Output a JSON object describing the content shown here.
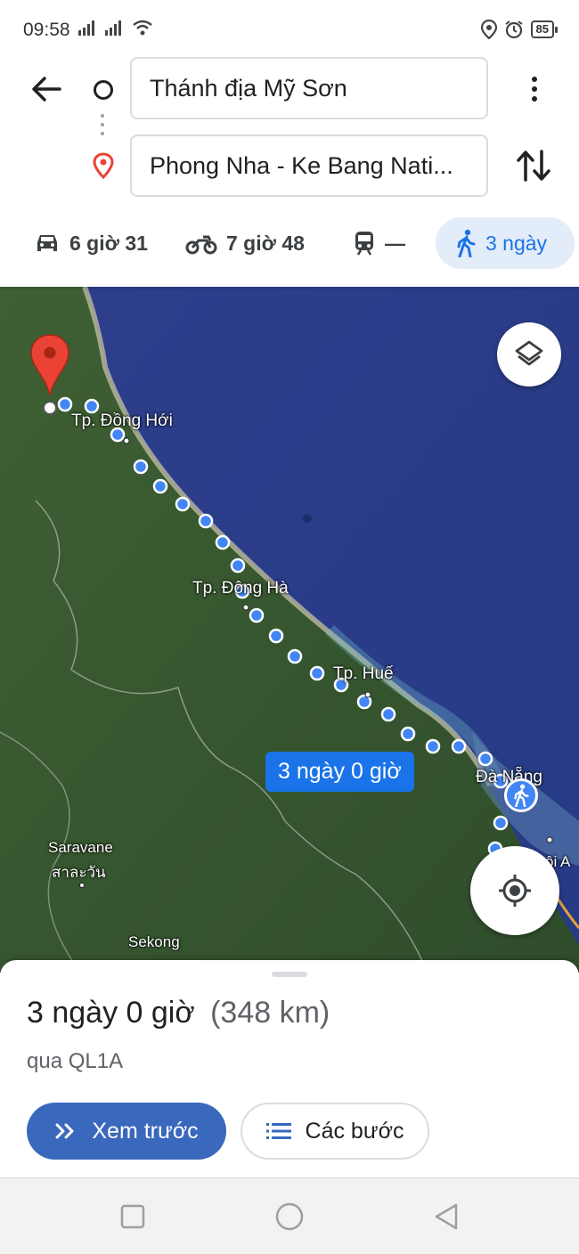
{
  "status_bar": {
    "time": "09:58",
    "battery": "85"
  },
  "route": {
    "origin": "Thánh địa Mỹ Sơn",
    "destination": "Phong Nha - Ke Bang Nati..."
  },
  "modes": {
    "car": "6 giờ 31",
    "motorbike": "7 giờ 48",
    "transit": "—",
    "walk": "3 ngày"
  },
  "map": {
    "labels": {
      "dong_hoi": "Tp. Đồng Hới",
      "dong_ha": "Tp. Đông Hà",
      "hue": "Tp. Huế",
      "da_nang": "Đà Nẵng",
      "saravane": "Saravane",
      "saravane_lao": "สาละวัน",
      "sekong": "Sekong",
      "hoi_an": "ội A"
    },
    "route_bubble": "3 ngày 0 giờ"
  },
  "sheet": {
    "duration": "3 ngày 0 giờ",
    "distance": "(348 km)",
    "via": "qua QL1A",
    "preview_label": "Xem trước",
    "steps_label": "Các bước"
  },
  "colors": {
    "accent": "#1a73e8",
    "preview_button": "#3a68bd",
    "pin": "#ea4335",
    "route_dot": "#4285f4"
  }
}
